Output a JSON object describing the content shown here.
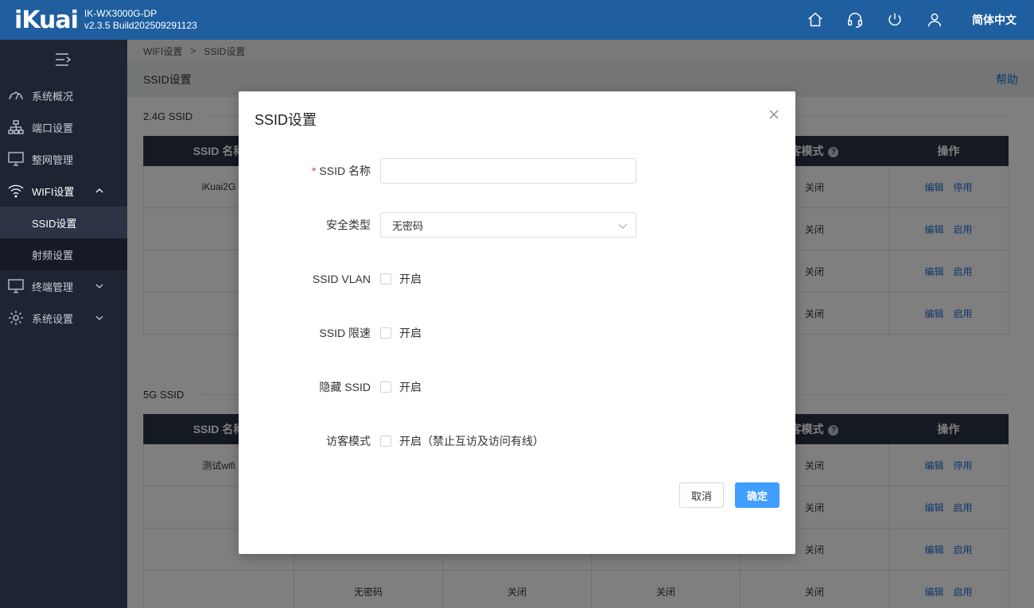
{
  "header": {
    "logo": "iKuai",
    "model": "IK-WX3000G-DP",
    "version": "v2.3.5 Build2025092911 23",
    "icons": [
      "home-icon",
      "headset-icon",
      "power-icon",
      "user-icon"
    ],
    "language": "简体中文"
  },
  "sidebar": {
    "items": [
      {
        "label": "系统概况",
        "icon": "dashboard-icon"
      },
      {
        "label": "端口设置",
        "icon": "network-icon"
      },
      {
        "label": "整网管理",
        "icon": "monitor-icon"
      },
      {
        "label": "WIFI设置",
        "icon": "wifi-icon"
      },
      {
        "label": "终端管理",
        "icon": "terminal-icon"
      },
      {
        "label": "系统设置",
        "icon": "gear-icon"
      }
    ],
    "wifi_sub": [
      {
        "label": "SSID设置"
      },
      {
        "label": "射频设置"
      }
    ]
  },
  "breadcrumb": {
    "parent": "WIFI设置",
    "sep": ">",
    "current": "SSID设置"
  },
  "page": {
    "title": "SSID设置",
    "help": "帮助"
  },
  "sections": {
    "s24": {
      "title": "2.4G SSID",
      "headers": {
        "name": "SSID 名称",
        "guest": "客模式",
        "op": "操作"
      },
      "rows": [
        {
          "name": "iKuai2G",
          "guest": "关闭",
          "edit": "编辑",
          "toggle": "停用"
        },
        {
          "name": "",
          "guest": "关闭",
          "edit": "编辑",
          "toggle": "启用"
        },
        {
          "name": "",
          "guest": "关闭",
          "edit": "编辑",
          "toggle": "启用"
        },
        {
          "name": "",
          "guest": "关闭",
          "edit": "编辑",
          "toggle": "启用"
        }
      ]
    },
    "s5": {
      "title": "5G SSID",
      "headers": {
        "name": "SSID 名称",
        "guest": "客模式",
        "op": "操作"
      },
      "rows": [
        {
          "name": "测试wifi",
          "c2": "",
          "c3": "",
          "c4": "",
          "guest": "关闭",
          "edit": "编辑",
          "toggle": "停用"
        },
        {
          "name": "",
          "c2": "",
          "c3": "",
          "c4": "",
          "guest": "关闭",
          "edit": "编辑",
          "toggle": "启用"
        },
        {
          "name": "",
          "c2": "",
          "c3": "",
          "c4": "",
          "guest": "关闭",
          "edit": "编辑",
          "toggle": "启用"
        },
        {
          "name": "",
          "c2": "无密码",
          "c3": "关闭",
          "c4": "关闭",
          "guest": "关闭",
          "edit": "编辑",
          "toggle": "启用"
        }
      ]
    }
  },
  "modal": {
    "title": "SSID设置",
    "fields": {
      "ssid_name": {
        "label": "SSID 名称",
        "required_mark": "*",
        "value": "",
        "placeholder": ""
      },
      "security": {
        "label": "安全类型",
        "value": "无密码"
      },
      "vlan": {
        "label": "SSID VLAN",
        "option": "开启"
      },
      "speed": {
        "label": "SSID 限速",
        "option": "开启"
      },
      "hide": {
        "label": "隐藏 SSID",
        "option": "开启"
      },
      "guest": {
        "label": "访客模式",
        "option": "开启（禁止互访及访问有线）"
      }
    },
    "cancel": "取消",
    "ok": "确定"
  }
}
